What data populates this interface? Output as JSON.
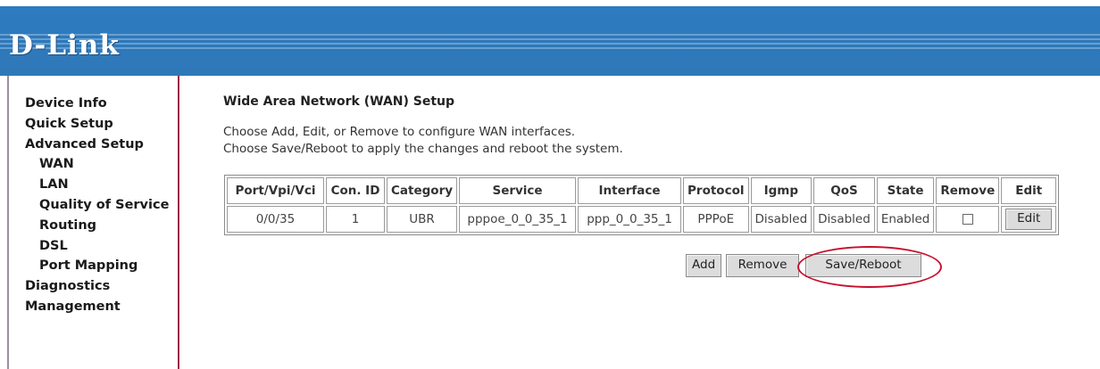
{
  "brand": {
    "logo": "D-Link"
  },
  "sidebar": {
    "items": [
      {
        "label": "Device Info"
      },
      {
        "label": "Quick Setup"
      },
      {
        "label": "Advanced Setup"
      },
      {
        "label": "WAN"
      },
      {
        "label": "LAN"
      },
      {
        "label": "Quality of Service"
      },
      {
        "label": "Routing"
      },
      {
        "label": "DSL"
      },
      {
        "label": "Port Mapping"
      },
      {
        "label": "Diagnostics"
      },
      {
        "label": "Management"
      }
    ]
  },
  "main": {
    "title": "Wide Area Network (WAN) Setup",
    "desc_line1": "Choose Add, Edit, or Remove to configure WAN interfaces.",
    "desc_line2": "Choose Save/Reboot to apply the changes and reboot the system."
  },
  "table": {
    "headers": [
      "Port/Vpi/Vci",
      "Con. ID",
      "Category",
      "Service",
      "Interface",
      "Protocol",
      "Igmp",
      "QoS",
      "State",
      "Remove",
      "Edit"
    ],
    "rows": [
      {
        "port": "0/0/35",
        "con_id": "1",
        "category": "UBR",
        "service": "pppoe_0_0_35_1",
        "interface": "ppp_0_0_35_1",
        "protocol": "PPPoE",
        "igmp": "Disabled",
        "qos": "Disabled",
        "state": "Enabled",
        "remove_checked": false,
        "edit_label": "Edit"
      }
    ]
  },
  "buttons": {
    "add": "Add",
    "remove": "Remove",
    "save_reboot": "Save/Reboot"
  },
  "colors": {
    "header_blue": "#2e7bc0",
    "sidebar_border": "#9a2a45",
    "highlight_red": "#c8102e",
    "button_gray": "#dcdcdc"
  }
}
